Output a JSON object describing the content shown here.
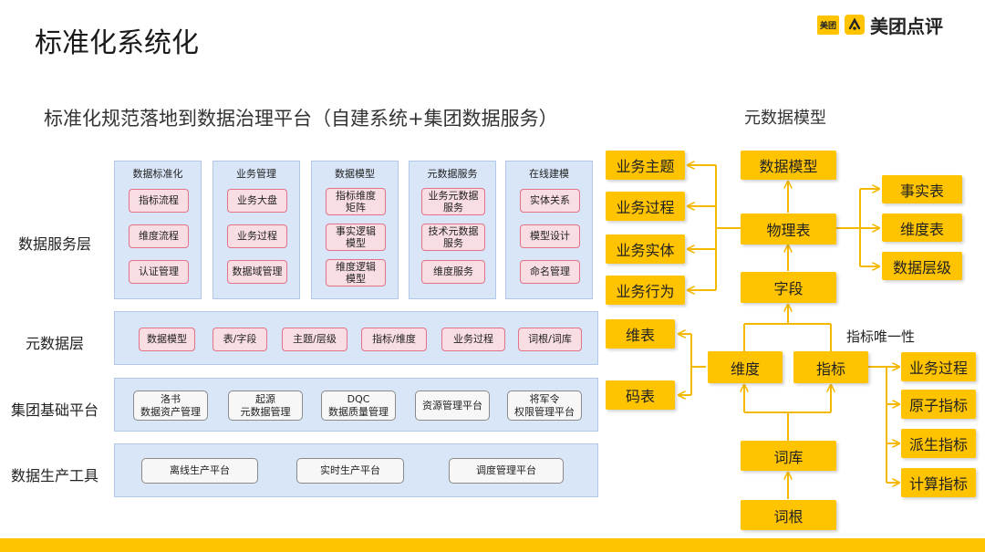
{
  "title": "标准化系统化",
  "brand": {
    "small": "美团",
    "name": "美团点评"
  },
  "subtitle": "标准化规范落地到数据治理平台（自建系统+集团数据服务）",
  "model_title": "元数据模型",
  "layers": {
    "service": {
      "label": "数据服务层",
      "columns": [
        {
          "title": "数据标准化",
          "items": [
            "指标流程",
            "维度流程",
            "认证管理"
          ]
        },
        {
          "title": "业务管理",
          "items": [
            "业务大盘",
            "业务过程",
            "数据域管理"
          ]
        },
        {
          "title": "数据模型",
          "items": [
            "指标维度\n矩阵",
            "事实逻辑\n模型",
            "维度逻辑\n模型"
          ]
        },
        {
          "title": "元数据服务",
          "items": [
            "业务元数据\n服务",
            "技术元数据\n服务",
            "维度服务"
          ]
        },
        {
          "title": "在线建模",
          "items": [
            "实体关系",
            "模型设计",
            "命名管理"
          ]
        }
      ]
    },
    "metadata": {
      "label": "元数据层",
      "items": [
        "数据模型",
        "表/字段",
        "主题/层级",
        "指标/维度",
        "业务过程",
        "词根/词库"
      ]
    },
    "platform": {
      "label": "集团基础平台",
      "items": [
        "洛书\n数据资产管理",
        "起源\n元数据管理",
        "DQC\n数据质量管理",
        "资源管理平台",
        "将军令\n权限管理平台"
      ]
    },
    "production": {
      "label": "数据生产工具",
      "items": [
        "离线生产平台",
        "实时生产平台",
        "调度管理平台"
      ]
    }
  },
  "model": {
    "left_business": [
      "业务主题",
      "业务过程",
      "业务实体",
      "业务行为"
    ],
    "data_model": "数据模型",
    "physical_table": "物理表",
    "right_tables": [
      "事实表",
      "维度表",
      "数据层级"
    ],
    "field": "字段",
    "dimension": "维度",
    "metric": "指标",
    "dim_tables": [
      "维表",
      "码表"
    ],
    "unique_note": "指标唯一性",
    "metric_types": [
      "业务过程",
      "原子指标",
      "派生指标",
      "计算指标"
    ],
    "lexicon": "词库",
    "root": "词根"
  },
  "colors": {
    "accent": "#ffc300",
    "panel": "#d9e6f7",
    "pink_border": "#e27189",
    "pink_fill": "#f8dde3"
  }
}
